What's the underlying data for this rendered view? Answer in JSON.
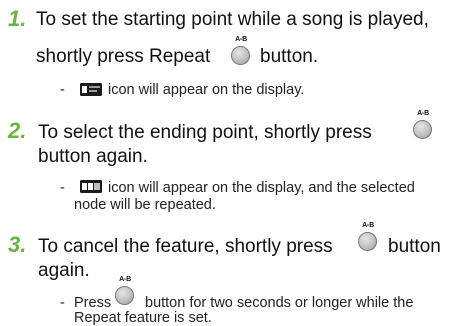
{
  "steps": [
    {
      "number": "1.",
      "line1": "To set the starting point while a song is played,",
      "line2_before": "shortly press Repeat",
      "line2_after": "button.",
      "note_dash": "-",
      "note_line1": "icon will appear on the display."
    },
    {
      "number": "2.",
      "line1_before": "To select the ending point, shortly press",
      "line2": "button again.",
      "note_dash": "-",
      "note_line1": "icon will appear on the display, and the selected",
      "note_line2": "node will be repeated."
    },
    {
      "number": "3.",
      "line1_before": "To cancel the feature, shortly press",
      "line1_after": "button",
      "line2": "again.",
      "note_dash": "-",
      "note_line1_before": "Press",
      "note_line1_after": "button for two seconds or longer while the",
      "note_line2": "Repeat feature is set."
    }
  ],
  "button_label": "A-B",
  "icons": {
    "repeat_button": "ab-repeat-button-icon",
    "display_a": "repeat-a-display-icon",
    "display_ab": "repeat-ab-display-icon"
  },
  "colors": {
    "step_number": "#6db33f",
    "text": "#111111"
  }
}
